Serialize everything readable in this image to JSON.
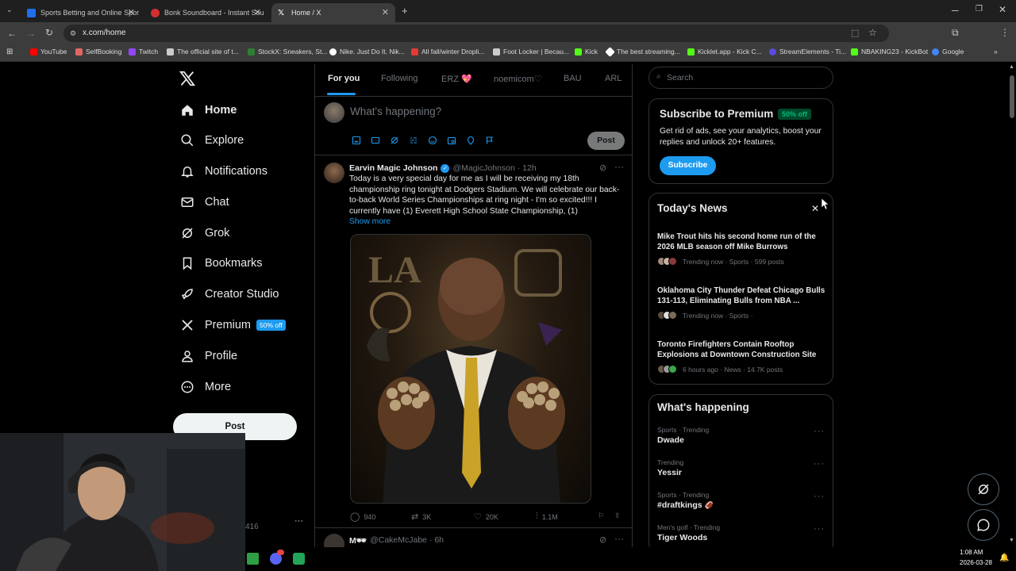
{
  "browser": {
    "tabs": [
      {
        "title": "Sports Betting and Online Spor",
        "color": "#1f6feb"
      },
      {
        "title": "Bonk Soundboard - Instant Sou",
        "color": "#d32f2f"
      },
      {
        "title": "Home / X",
        "color": "#ffffff"
      }
    ],
    "url": "x.com/home",
    "bookmarks": [
      {
        "label": "YouTube",
        "color": "#ff0000"
      },
      {
        "label": "SelfBooking",
        "color": "#e06666"
      },
      {
        "label": "Twitch",
        "color": "#9146ff"
      },
      {
        "label": "The official site of t...",
        "color": "#cccccc"
      },
      {
        "label": "StockX: Sneakers, St...",
        "color": "#2e7d32"
      },
      {
        "label": "Nike. Just Do It. Nik...",
        "color": "#ffffff"
      },
      {
        "label": "All fall/winter Dropli...",
        "color": "#e53935"
      },
      {
        "label": "Foot Locker | Becau...",
        "color": "#cccccc"
      },
      {
        "label": "Kick",
        "color": "#53fc18"
      },
      {
        "label": "The best streaming...",
        "color": "#ffffff"
      },
      {
        "label": "Kicklet.app - Kick C...",
        "color": "#53fc18"
      },
      {
        "label": "StreamElements - Ti...",
        "color": "#5b4bdb"
      },
      {
        "label": "NBAKING23 - KickBot",
        "color": "#53fc18"
      },
      {
        "label": "Google",
        "color": "#4285f4"
      }
    ]
  },
  "nav": {
    "items": [
      {
        "label": "Home",
        "icon": "home-icon"
      },
      {
        "label": "Explore",
        "icon": "search-icon"
      },
      {
        "label": "Notifications",
        "icon": "bell-icon"
      },
      {
        "label": "Chat",
        "icon": "envelope-icon"
      },
      {
        "label": "Grok",
        "icon": "grok-icon"
      },
      {
        "label": "Bookmarks",
        "icon": "bookmark-icon"
      },
      {
        "label": "Creator Studio",
        "icon": "rocket-icon"
      },
      {
        "label": "Premium",
        "icon": "x-logo-icon",
        "badge": "50% off"
      },
      {
        "label": "Profile",
        "icon": "person-icon"
      },
      {
        "label": "More",
        "icon": "more-circle-icon"
      }
    ],
    "post_label": "Post",
    "account_partial": "416"
  },
  "feed": {
    "tabs": [
      "For you",
      "Following",
      "ERZ 💖",
      "noemicom♡",
      "BAU",
      "ARL"
    ],
    "composer_placeholder": "What's happening?",
    "composer_post": "Post",
    "tweet": {
      "name": "Earvin Magic Johnson",
      "handle": "@MagicJohnson · 12h",
      "text": "Today is a very special day for me as I will be receiving my 18th championship ring tonight at Dodgers Stadium. We will celebrate our back-to-back World Series Championships at ring night - I'm so excited!!! I currently have (1) Everett High School State Championship, (1)",
      "show_more": "Show more",
      "replies": "940",
      "reposts": "3K",
      "likes": "20K",
      "views": "1.1M"
    },
    "next_tweet": {
      "name": "M🕶",
      "handle": "@CakeMcJabe · 6h"
    }
  },
  "sidebar": {
    "search_placeholder": "Search",
    "premium": {
      "title": "Subscribe to Premium",
      "badge": "50% off",
      "text": "Get rid of ads, see your analytics, boost your replies and unlock 20+ features.",
      "button": "Subscribe"
    },
    "news": {
      "title": "Today's News",
      "items": [
        {
          "title": "Mike Trout hits his second home run of the 2026 MLB season off Mike Burrows",
          "meta": "Trending now · Sports · 599 posts"
        },
        {
          "title": "Oklahoma City Thunder Defeat Chicago Bulls 131-113, Eliminating Bulls from NBA ...",
          "meta": "Trending now · Sports ·"
        },
        {
          "title": "Toronto Firefighters Contain Rooftop Explosions at Downtown Construction Site",
          "meta": "6 hours ago · News · 14.7K posts"
        }
      ]
    },
    "happening": {
      "title": "What's happening",
      "items": [
        {
          "cat": "Sports · Trending",
          "name": "Dwade"
        },
        {
          "cat": "Trending",
          "name": "Yessir"
        },
        {
          "cat": "Sports · Trending",
          "name": "#draftkings"
        },
        {
          "cat": "Men's golf · Trending",
          "name": "Tiger Woods"
        }
      ]
    }
  },
  "system": {
    "time": "1:08 AM",
    "date": "2026-03-28"
  },
  "colors": {
    "accent": "#1d9bf0",
    "badge_green": "#00ba7c"
  }
}
